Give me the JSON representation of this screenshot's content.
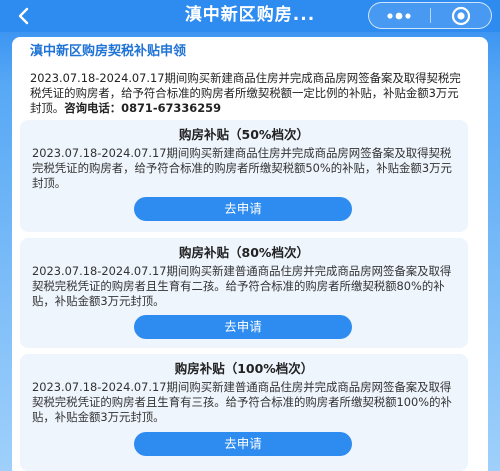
{
  "navbar": {
    "title": "滇中新区购房...",
    "back_icon": "back-chevron-icon",
    "more_icon": "more-dots-icon",
    "close_icon": "target-circle-icon"
  },
  "main": {
    "title": "滇中新区购房契税补贴申领",
    "intro": "2023.07.18-2024.07.17期间购买新建商品住房并完成商品房网签备案及取得契税完税凭证的购房者，给予符合标准的购房者所缴契税额一定比例的补贴，补贴金额3万元封顶。",
    "contact_label": "咨询电话：",
    "contact_phone": "0871-67336259"
  },
  "cards": [
    {
      "title": "购房补贴（50%档次）",
      "desc": "2023.07.18-2024.07.17期间购买新建商品住房并完成商品房网签备案及取得契税完税凭证的购房者，给予符合标准的购房者所缴契税额50%的补贴，补贴金额3万元封顶。",
      "button": "去申请"
    },
    {
      "title": "购房补贴（80%档次）",
      "desc": "2023.07.18-2024.07.17期间购买新建普通商品住房并完成商品房网签备案及取得契税完税凭证的购房者且生育有二孩。给予符合标准的购房者所缴契税额80%的补贴，补贴金额3万元封顶。",
      "button": "去申请"
    },
    {
      "title": "购房补贴（100%档次）",
      "desc": "2023.07.18-2024.07.17期间购买新建普通商品住房并完成商品房网签备案及取得契税完税凭证的购房者且生育有三孩。给予符合标准的购房者所缴契税额100%的补贴，补贴金额3万元封顶。",
      "button": "去申请"
    }
  ],
  "colors": {
    "primary": "#2e8bf0",
    "title_blue": "#1f73d6",
    "card_bg": "#eef5fd"
  }
}
